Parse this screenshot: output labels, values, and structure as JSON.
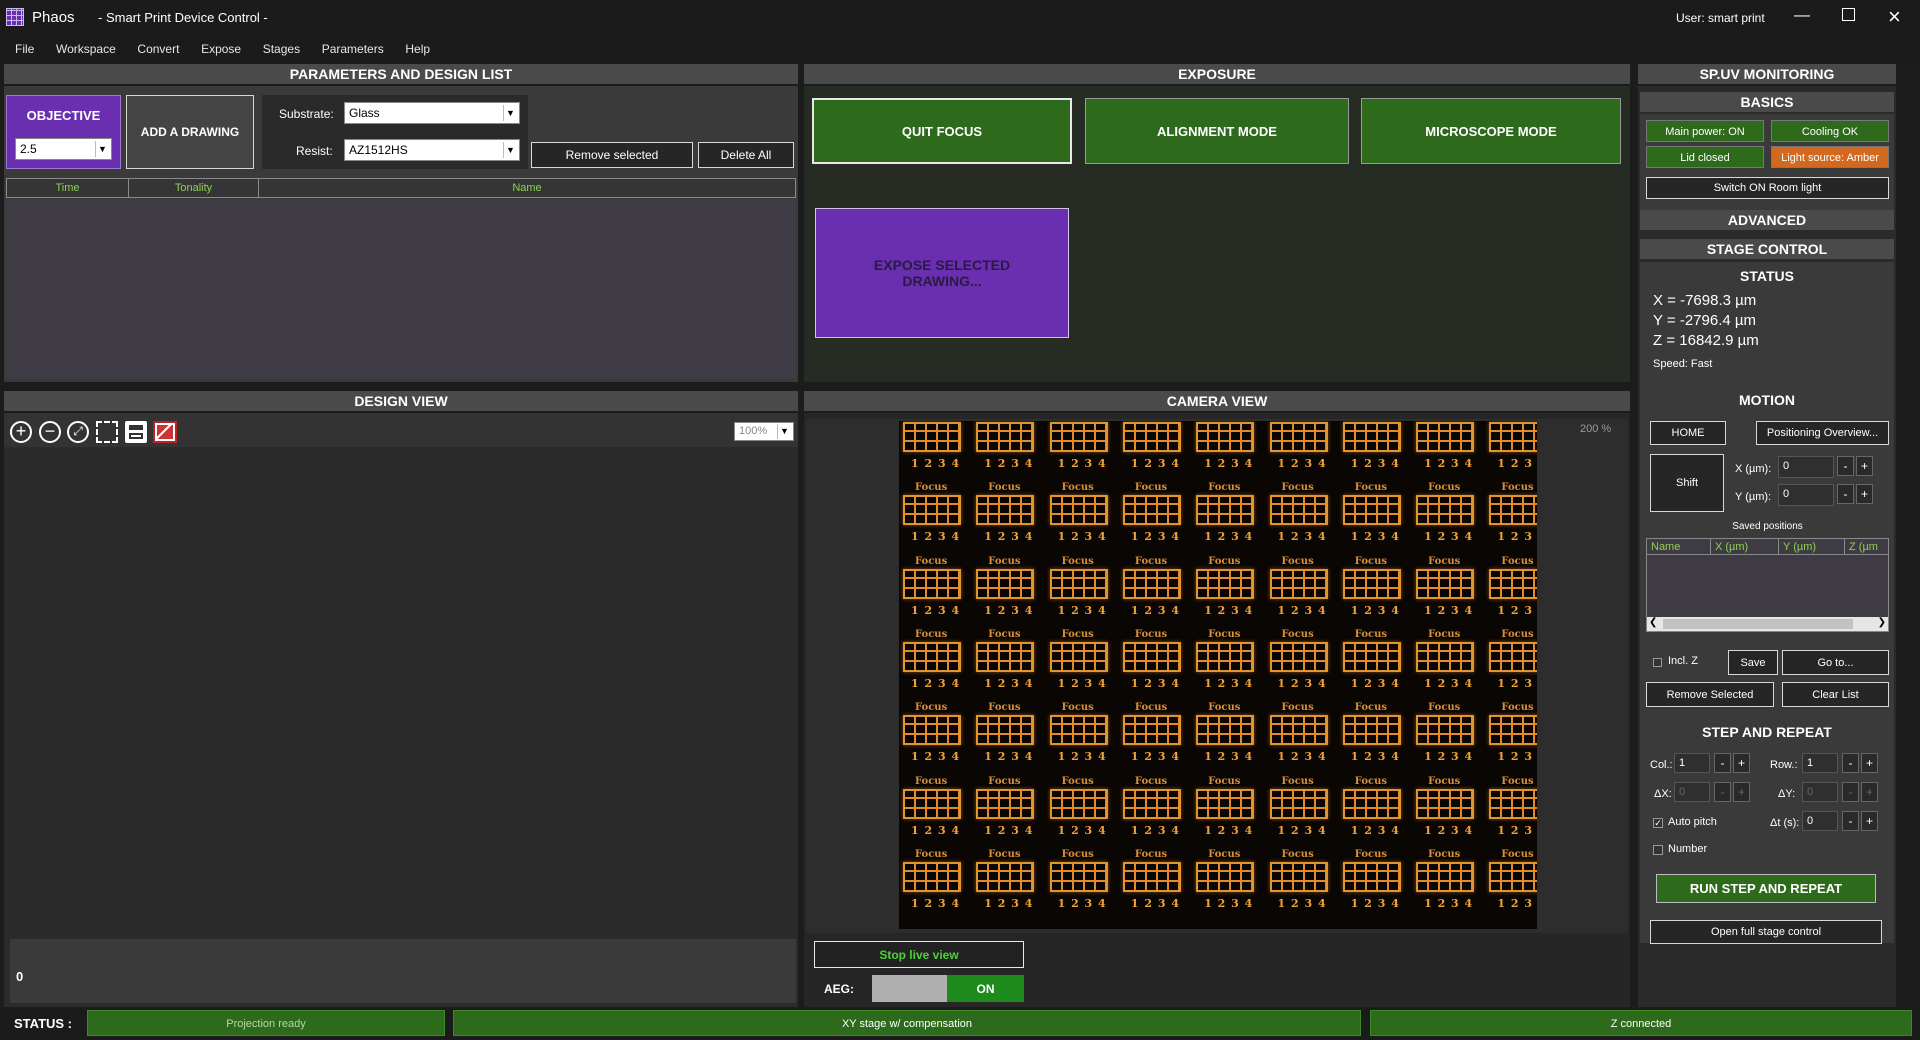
{
  "app": {
    "name": "Phaos",
    "subtitle": "- Smart Print Device Control -",
    "user": "User: smart print"
  },
  "menu": [
    "File",
    "Workspace",
    "Convert",
    "Expose",
    "Stages",
    "Parameters",
    "Help"
  ],
  "params": {
    "title": "PARAMETERS AND DESIGN LIST",
    "objective_label": "OBJECTIVE",
    "objective_value": "2.5",
    "add_drawing": "ADD A DRAWING",
    "substrate_label": "Substrate:",
    "substrate_value": "Glass",
    "resist_label": "Resist:",
    "resist_value": "AZ1512HS",
    "remove_selected": "Remove selected",
    "delete_all": "Delete All",
    "columns": [
      "Time",
      "Tonality",
      "Name"
    ]
  },
  "exposure": {
    "title": "EXPOSURE",
    "quit_focus": "QUIT FOCUS",
    "alignment_mode": "ALIGNMENT MODE",
    "microscope_mode": "MICROSCOPE MODE",
    "expose_selected": "EXPOSE SELECTED DRAWING..."
  },
  "design": {
    "title": "DESIGN VIEW",
    "zoom": "100%",
    "counter": "0"
  },
  "camera": {
    "title": "CAMERA VIEW",
    "zoom": "200 %",
    "stop_live": "Stop live view",
    "aeg_label": "AEG:",
    "aeg_state": "ON",
    "pattern_focus": "Focus",
    "pattern_digits": "1 2 3 4"
  },
  "monitor": {
    "title": "SP.UV MONITORING",
    "basics": "BASICS",
    "main_power": "Main power: ON",
    "cooling": "Cooling OK",
    "lid": "Lid closed",
    "light_source": "Light source: Amber",
    "room_light": "Switch ON Room light",
    "advanced": "ADVANCED",
    "stage_control": "STAGE CONTROL",
    "status": "STATUS",
    "x": "X = -7698.3 µm",
    "y": "Y = -2796.4 µm",
    "z": "Z = 16842.9 µm",
    "speed": "Speed: Fast",
    "motion": "MOTION",
    "home": "HOME",
    "positioning": "Positioning Overview...",
    "shift": "Shift",
    "x_label": "X (µm):",
    "x_value": "0",
    "y_label": "Y (µm):",
    "y_value": "0",
    "saved_positions": "Saved positions",
    "saved_cols": [
      "Name",
      "X (µm)",
      "Y (µm)",
      "Z (µm"
    ],
    "incl_z": "Incl. Z",
    "save": "Save",
    "goto": "Go to...",
    "remove_selected": "Remove Selected",
    "clear_list": "Clear List",
    "step_repeat": "STEP AND REPEAT",
    "col_label": "Col.:",
    "col_value": "1",
    "row_label": "Row.:",
    "row_value": "1",
    "dx_label": "ΔX:",
    "dx_value": "0",
    "dy_label": "ΔY:",
    "dy_value": "0",
    "auto_pitch": "Auto pitch",
    "dt_label": "Δt (s):",
    "dt_value": "0",
    "number": "Number",
    "run": "RUN STEP AND REPEAT",
    "full_stage": "Open full stage control"
  },
  "statusbar": {
    "label": "STATUS :",
    "projection": "Projection ready",
    "xy_stage": "XY stage w/ compensation",
    "z": "Z connected"
  },
  "colors": {
    "green": "#2d6a1c",
    "purple": "#6a2fb0",
    "amber": "#d3691f",
    "panel": "#3a3a3a"
  }
}
